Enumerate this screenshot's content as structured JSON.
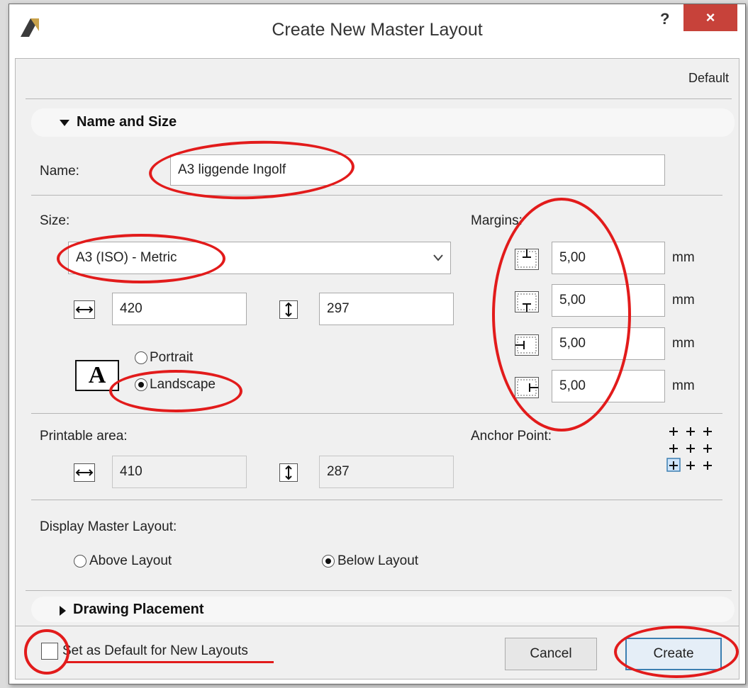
{
  "window": {
    "title": "Create New Master Layout",
    "help_label": "?",
    "close_label": "×"
  },
  "settings_label": "Default",
  "name_and_size": {
    "header": "Name and Size",
    "name_label": "Name:",
    "name_value": "A3 liggende Ingolf",
    "size_label": "Size:",
    "size_value": "A3 (ISO) - Metric",
    "width": "420",
    "height": "297",
    "orientation_preview_glyph": "A",
    "portrait_label": "Portrait",
    "landscape_label": "Landscape",
    "orientation_selected": "Landscape",
    "margins_label": "Margins:",
    "margins": [
      {
        "value": "5,00",
        "unit": "mm"
      },
      {
        "value": "5,00",
        "unit": "mm"
      },
      {
        "value": "5,00",
        "unit": "mm"
      },
      {
        "value": "5,00",
        "unit": "mm"
      }
    ],
    "printable_area_label": "Printable area:",
    "printable_width": "410",
    "printable_height": "287",
    "anchor_point_label": "Anchor Point:",
    "display_label": "Display Master Layout:",
    "above_label": "Above Layout",
    "below_label": "Below Layout",
    "display_selected": "Below Layout"
  },
  "drawing_placement": {
    "header": "Drawing Placement"
  },
  "footer": {
    "default_checkbox_label": "Set as Default for New Layouts",
    "default_checked": false,
    "cancel_label": "Cancel",
    "create_label": "Create"
  },
  "colors": {
    "annotation_red": "#e21b1b",
    "close_button": "#c7423a",
    "primary_border": "#3c7fb1"
  }
}
